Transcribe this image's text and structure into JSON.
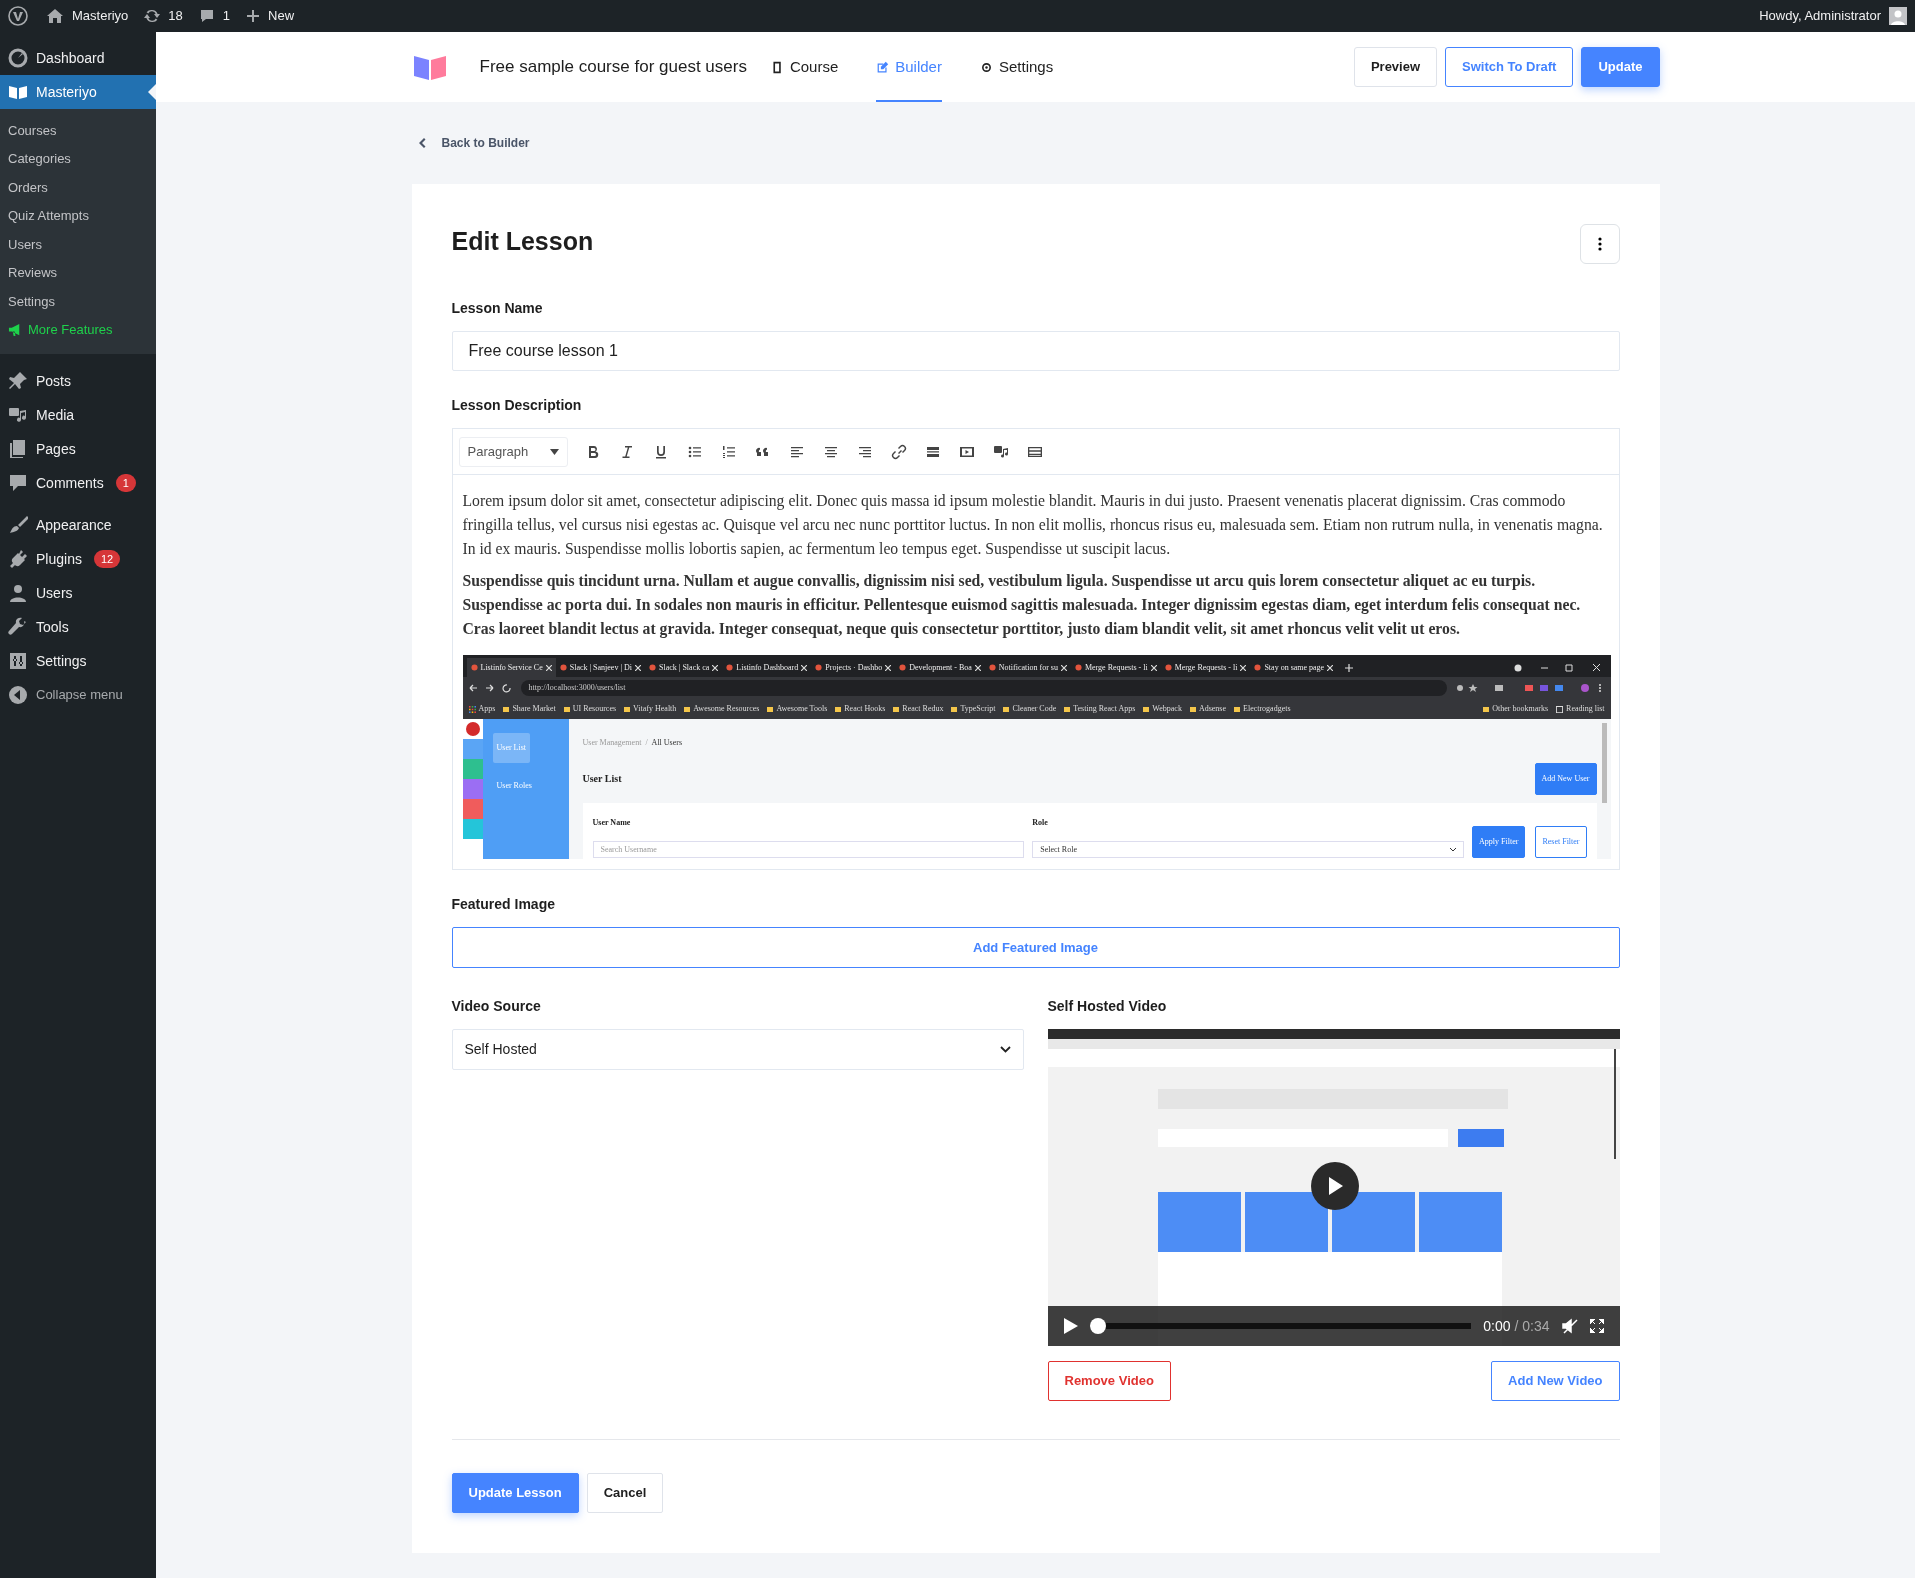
{
  "admin_bar": {
    "site": "Masteriyo",
    "updates": "18",
    "comments": "1",
    "new": "New",
    "greeting": "Howdy, Administrator"
  },
  "sidebar": {
    "items": [
      {
        "label": "Dashboard",
        "selected": false
      },
      {
        "label": "Masteriyo",
        "selected": true,
        "children": [
          {
            "label": "Courses",
            "kind": "link"
          },
          {
            "label": "Categories",
            "kind": "link"
          },
          {
            "label": "Orders",
            "kind": "link"
          },
          {
            "label": "Quiz Attempts",
            "kind": "link"
          },
          {
            "label": "Users",
            "kind": "link"
          },
          {
            "label": "Reviews",
            "kind": "link"
          },
          {
            "label": "Settings",
            "kind": "link"
          },
          {
            "label": "More Features",
            "kind": "promo"
          }
        ]
      },
      {
        "label": "Posts",
        "selected": false
      },
      {
        "label": "Media",
        "selected": false
      },
      {
        "label": "Pages",
        "selected": false
      },
      {
        "label": "Comments",
        "selected": false,
        "badge": "1"
      },
      {
        "label": "Appearance",
        "selected": false
      },
      {
        "label": "Plugins",
        "selected": false,
        "badge": "12"
      },
      {
        "label": "Users",
        "selected": false
      },
      {
        "label": "Tools",
        "selected": false
      },
      {
        "label": "Settings",
        "selected": false
      },
      {
        "label": "Collapse menu",
        "selected": false
      }
    ]
  },
  "header": {
    "course_title": "Free sample course for guest users",
    "tabs": [
      {
        "label": "Course",
        "selected": false
      },
      {
        "label": "Builder",
        "selected": true
      },
      {
        "label": "Settings",
        "selected": false
      }
    ],
    "buttons": [
      {
        "label": "Preview",
        "kind": "plain"
      },
      {
        "label": "Switch To Draft",
        "kind": "outline"
      },
      {
        "label": "Update",
        "kind": "primary"
      }
    ]
  },
  "back_link": "Back to Builder",
  "form": {
    "title": "Edit Lesson",
    "lesson_name": {
      "label": "Lesson Name",
      "value": "Free course lesson 1"
    },
    "lesson_description": {
      "label": "Lesson Description",
      "format": "Paragraph",
      "paragraphs": [
        {
          "text": "Lorem ipsum dolor sit amet, consectetur adipiscing elit. Donec quis massa id ipsum molestie blandit. Mauris in dui justo. Praesent venenatis placerat dignissim. Cras commodo fringilla tellus, vel cursus nisi egestas ac. Quisque vel arcu nec nunc porttitor luctus. In non elit mollis, rhoncus risus eu, malesuada sem. Etiam non rutrum nulla, in venenatis magna. In id ex mauris. Suspendisse mollis lobortis sapien, ac fermentum leo tempus eget. Suspendisse ut suscipit lacus.",
          "bold": false
        },
        {
          "text": "Suspendisse quis tincidunt urna. Nullam et augue convallis, dignissim nisi sed, vestibulum ligula. Suspendisse ut arcu quis lorem consectetur aliquet ac eu turpis. Suspendisse ac porta dui. In sodales non mauris in efficitur. Pellentesque euismod sagittis malesuada. Integer dignissim egestas diam, eget interdum felis consequat nec. Cras laoreet blandit lectus at gravida. Integer consequat, neque quis consectetur porttitor, justo diam blandit velit, sit amet rhoncus velit velit ut eros.",
          "bold": true
        }
      ],
      "embedded_screenshot": {
        "tabs": [
          {
            "label": "Listinfo Service Ce",
            "selected": true
          },
          {
            "label": "Slack | Sanjeev | Di",
            "selected": false
          },
          {
            "label": "Slack | Slack ca",
            "selected": false
          },
          {
            "label": "Listinfo Dashboard",
            "selected": false
          },
          {
            "label": "Projects · Dashbo",
            "selected": false
          },
          {
            "label": "Development - Boa",
            "selected": false
          },
          {
            "label": "Notification for su",
            "selected": false
          },
          {
            "label": "Merge Requests - li",
            "selected": false
          },
          {
            "label": "Merge Requests - li",
            "selected": false
          },
          {
            "label": "Stay on same page",
            "selected": false
          }
        ],
        "url": "http://localhost:3000/users/list",
        "bookmarks": [
          "Apps",
          "Share Market",
          "UI Resources",
          "Vitafy Health",
          "Awesome Resources",
          "Awesome Tools",
          "React Hooks",
          "React Redux",
          "TypeScript",
          "Cleaner Code",
          "Testing React Apps",
          "Webpack",
          "Adsense",
          "Electrogadgets"
        ],
        "other_bookmarks": [
          "Other bookmarks",
          "Reading list"
        ],
        "submenu": [
          {
            "label": "User List",
            "selected": true
          },
          {
            "label": "User Roles",
            "selected": false
          }
        ],
        "breadcrumb": [
          "User Management",
          "/",
          "All Users"
        ],
        "title": "User List",
        "add_button": "Add New User",
        "filters": {
          "user_label": "User Name",
          "user_placeholder": "Search Username",
          "role_label": "Role",
          "role_value": "Select Role",
          "apply": "Apply Filter",
          "reset": "Reset Filter"
        }
      }
    },
    "featured_image": {
      "label": "Featured Image",
      "button": "Add Featured Image"
    },
    "video_source": {
      "label": "Video Source",
      "value": "Self Hosted"
    },
    "self_hosted_video": {
      "label": "Self Hosted Video",
      "current_time": "0:00",
      "duration": "/ 0:34",
      "level": 0
    },
    "video_buttons": [
      {
        "label": "Remove Video",
        "kind": "danger"
      },
      {
        "label": "Add New Video",
        "kind": "outline"
      }
    ],
    "footer_buttons": [
      {
        "label": "Update Lesson",
        "kind": "primary"
      },
      {
        "label": "Cancel",
        "kind": "plain"
      }
    ]
  }
}
